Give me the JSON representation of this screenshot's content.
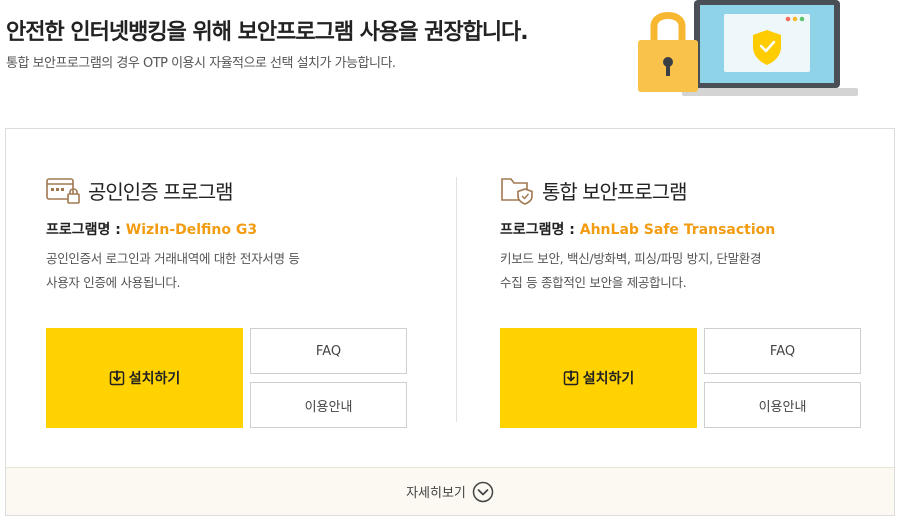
{
  "header": {
    "title": "안전한 인터넷뱅킹을 위해 보안프로그램 사용을 권장합니다.",
    "subtitle": "통합 보안프로그램의 경우 OTP 이용시 자율적으로 선택 설치가 가능합니다."
  },
  "illustration": {
    "lock_color": "#f7b731",
    "screen_color": "#8fd3e8",
    "shield_color": "#ffcc00"
  },
  "programs": [
    {
      "title": "공인인증 프로그램",
      "icon": "certificate-lock-icon",
      "name_label": "프로그램명 : ",
      "name": "WizIn-Delfino G3",
      "desc_line1": "공인인증서 로그인과 거래내역에 대한 전자서명 등",
      "desc_line2": "사용자 인증에 사용됩니다.",
      "install_label": "설치하기",
      "faq_label": "FAQ",
      "guide_label": "이용안내"
    },
    {
      "title": "통합 보안프로그램",
      "icon": "folder-shield-icon",
      "name_label": "프로그램명 : ",
      "name": "AhnLab Safe Transaction",
      "desc_line1": "키보드 보안, 백신/방화벽, 피싱/파밍 방지, 단말환경",
      "desc_line2": "수집 등 종합적인 보안을 제공합니다.",
      "install_label": "설치하기",
      "faq_label": "FAQ",
      "guide_label": "이용안내"
    }
  ],
  "more": {
    "label": "자세히보기",
    "icon": "chevron-down-circle-icon"
  },
  "colors": {
    "accent": "#ffd200",
    "program_name": "#f39c12",
    "more_bg": "#fbf9f2"
  }
}
